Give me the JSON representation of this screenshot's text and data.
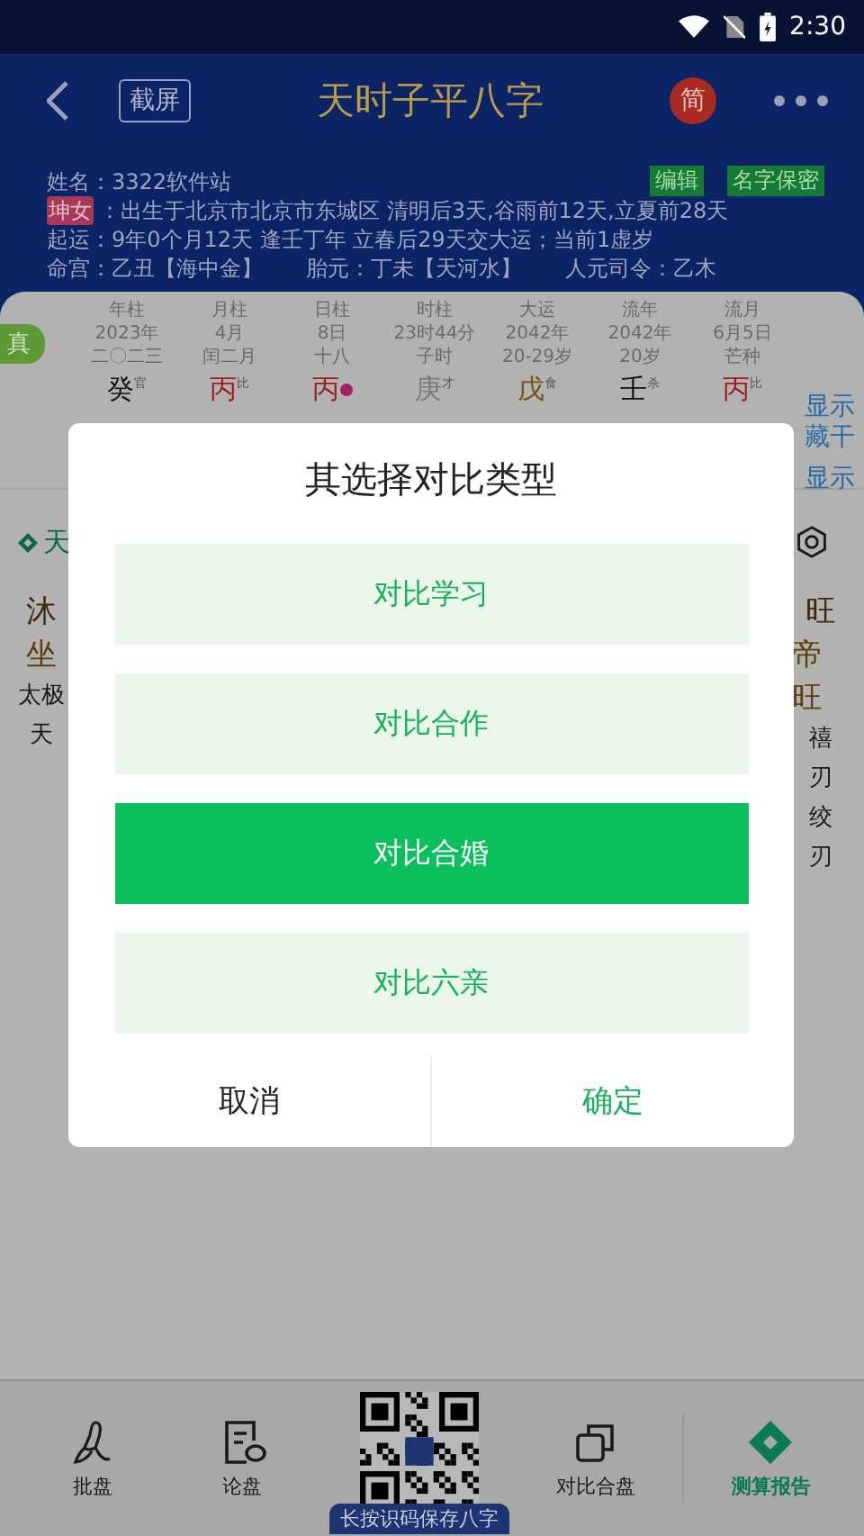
{
  "status_bar": {
    "time": "2:30"
  },
  "header": {
    "screenshot_button": "截屏",
    "title": "天时子平八字",
    "lang_badge": "简"
  },
  "profile": {
    "name_line": "姓名：3322软件站",
    "edit_button": "编辑",
    "hide_name_button": "名字保密",
    "gender_tag": "坤女",
    "birth_line": "：出生于北京市北京市东城区 清明后3天,谷雨前12天,立夏前28天",
    "luck_line": "起运：9年0个月12天 逢壬丁年 立春后29天交大运；当前1虚岁",
    "palace_items": [
      "命宫：乙丑【海中金】",
      "胎元：丁未【天河水】",
      "人元司令：乙木"
    ]
  },
  "chart": {
    "true_tag": "真",
    "pillars": [
      {
        "title": "年柱",
        "line_1": "2023年",
        "line_2": "二〇二三",
        "stem": "癸",
        "god": "官",
        "color": "#111111",
        "dot": false
      },
      {
        "title": "月柱",
        "line_1": "4月",
        "line_2": "闰二月",
        "stem": "丙",
        "god": "比",
        "color": "#9a1c1c",
        "dot": false
      },
      {
        "title": "日柱",
        "line_1": "8日",
        "line_2": "十八",
        "stem": "丙",
        "color": "#9a1c1c",
        "dot": true
      },
      {
        "title": "时柱",
        "line_1": "23时44分",
        "line_2": "子时",
        "stem": "庚",
        "god": "才",
        "color": "#7a7a7a",
        "dot": false
      },
      {
        "title": "大运",
        "line_1": "2042年",
        "line_2": "20-29岁",
        "stem": "戊",
        "god": "食",
        "color": "#6e5514",
        "dot": false
      },
      {
        "title": "流年",
        "line_1": "2042年",
        "line_2": "20岁",
        "stem": "壬",
        "god": "杀",
        "color": "#111111",
        "dot": false
      },
      {
        "title": "流月",
        "line_1": "6月5日",
        "line_2": "芒种",
        "stem": "丙",
        "god": "比",
        "color": "#9a1c1c",
        "dot": false
      }
    ],
    "show_hidden_stems": "显示藏干",
    "show_link": "显示"
  },
  "section": {
    "title": "天"
  },
  "left_fragments": [
    {
      "text": "沐",
      "kind": "large"
    },
    {
      "text": "坐",
      "kind": "accent"
    },
    {
      "text": "太极",
      "kind": "small"
    },
    {
      "text": "天",
      "kind": "small"
    }
  ],
  "right_fragments": [
    {
      "text": "旺",
      "kind": "large"
    },
    {
      "text": "帝旺",
      "kind": "accent"
    },
    {
      "text": "禧",
      "kind": "small"
    },
    {
      "text": "刃",
      "kind": "small"
    },
    {
      "text": "绞",
      "kind": "small"
    },
    {
      "text": "刃",
      "kind": "small"
    }
  ],
  "dialog": {
    "title": "其选择对比类型",
    "options": [
      {
        "label": "对比学习",
        "selected": false
      },
      {
        "label": "对比合作",
        "selected": false
      },
      {
        "label": "对比合婚",
        "selected": true
      },
      {
        "label": "对比六亲",
        "selected": false
      }
    ],
    "cancel": "取消",
    "confirm": "确定"
  },
  "bottom_nav": [
    {
      "label": "批盘",
      "kind": "brush",
      "selected": false
    },
    {
      "label": "论盘",
      "kind": "doc",
      "selected": false
    },
    {
      "label": "长按识码保存八字",
      "kind": "qr"
    },
    {
      "label": "对比合盘",
      "kind": "copy",
      "selected": false
    },
    {
      "label": "测算报告",
      "kind": "diamond",
      "selected": true
    }
  ]
}
